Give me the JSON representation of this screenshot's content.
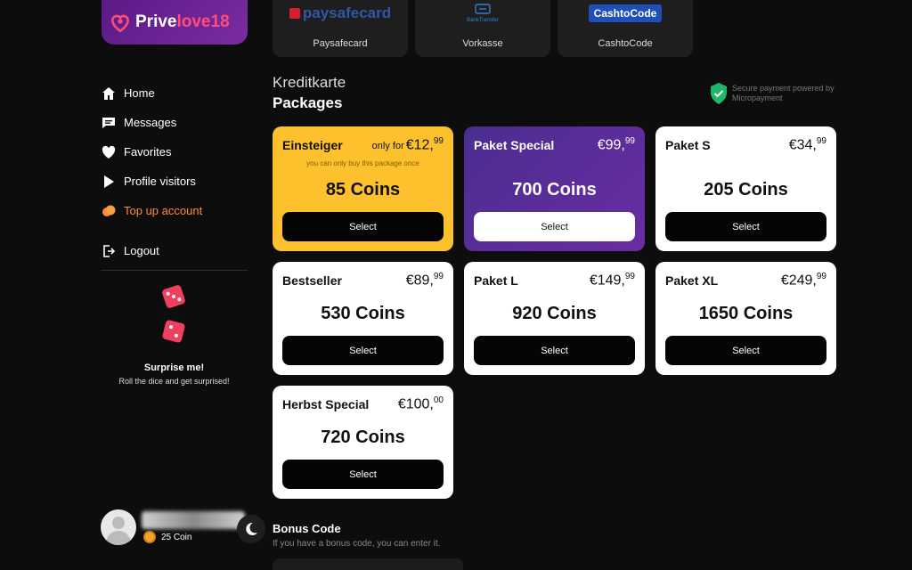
{
  "brand": {
    "name_part1": "Prive",
    "name_part2": "love18"
  },
  "sidebar": {
    "items": [
      {
        "label": "Home",
        "icon": "home-icon"
      },
      {
        "label": "Messages",
        "icon": "chat-icon"
      },
      {
        "label": "Favorites",
        "icon": "heart-icon"
      },
      {
        "label": "Profile visitors",
        "icon": "play-icon"
      },
      {
        "label": "Top up account",
        "icon": "coins-icon",
        "active": true
      }
    ],
    "logout": "Logout",
    "surprise_title": "Surprise me!",
    "surprise_sub": "Roll the dice and get surprised!"
  },
  "user": {
    "coins": "25 Coin"
  },
  "payment_methods": [
    {
      "label": "Paysafecard",
      "logo_text": "paysafecard"
    },
    {
      "label": "Vorkasse",
      "logo_text": "BankTransfer"
    },
    {
      "label": "CashtoCode",
      "logo_text": "CashtoCode"
    }
  ],
  "section": {
    "title": "Kreditkarte",
    "subtitle": "Packages",
    "secure_text": "Secure payment powered by Micropayment"
  },
  "packages": [
    {
      "name": "Einsteiger",
      "only_for": "only for",
      "price_main": "€12,",
      "price_cents": "99",
      "note": "you can only buy this package once",
      "coins": "85 Coins",
      "button": "Select"
    },
    {
      "name": "Paket Special",
      "price_main": "€99,",
      "price_cents": "99",
      "coins": "700 Coins",
      "button": "Select"
    },
    {
      "name": "Paket S",
      "price_main": "€34,",
      "price_cents": "99",
      "coins": "205 Coins",
      "button": "Select"
    },
    {
      "name": "Bestseller",
      "price_main": "€89,",
      "price_cents": "99",
      "coins": "530 Coins",
      "button": "Select"
    },
    {
      "name": "Paket L",
      "price_main": "€149,",
      "price_cents": "99",
      "coins": "920 Coins",
      "button": "Select"
    },
    {
      "name": "Paket XL",
      "price_main": "€249,",
      "price_cents": "99",
      "coins": "1650 Coins",
      "button": "Select"
    },
    {
      "name": "Herbst Special",
      "price_main": "€100,",
      "price_cents": "00",
      "coins": "720 Coins",
      "button": "Select"
    }
  ],
  "bonus": {
    "title": "Bonus Code",
    "subtitle": "If you have a bonus code, you can enter it."
  },
  "colors": {
    "accent_orange": "#ff8a3d",
    "yellow_card": "#fcc12d",
    "purple_card": "#5a2d9a"
  }
}
